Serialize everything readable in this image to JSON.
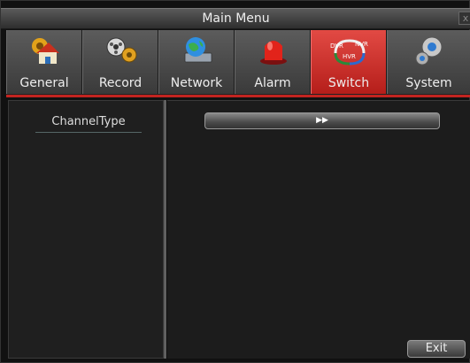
{
  "window": {
    "title": "Main Menu",
    "close_label": "x"
  },
  "tabs": [
    {
      "label": "General",
      "icon": "house-gear-icon",
      "active": false
    },
    {
      "label": "Record",
      "icon": "film-reels-icon",
      "active": false
    },
    {
      "label": "Network",
      "icon": "globe-laptop-icon",
      "active": false
    },
    {
      "label": "Alarm",
      "icon": "alarm-siren-icon",
      "active": false
    },
    {
      "label": "Switch",
      "icon": "dvr-nvr-hvr-switch-icon",
      "active": true,
      "icon_text": [
        "DVR",
        "NVR",
        "HVR"
      ]
    },
    {
      "label": "System",
      "icon": "gears-icon",
      "active": false
    }
  ],
  "left_panel": {
    "item": "ChannelType"
  },
  "right_panel": {
    "switch_arrow": "▶▶",
    "exit_label": "Exit"
  },
  "colors": {
    "accent": "#c22420",
    "background": "#111111"
  }
}
